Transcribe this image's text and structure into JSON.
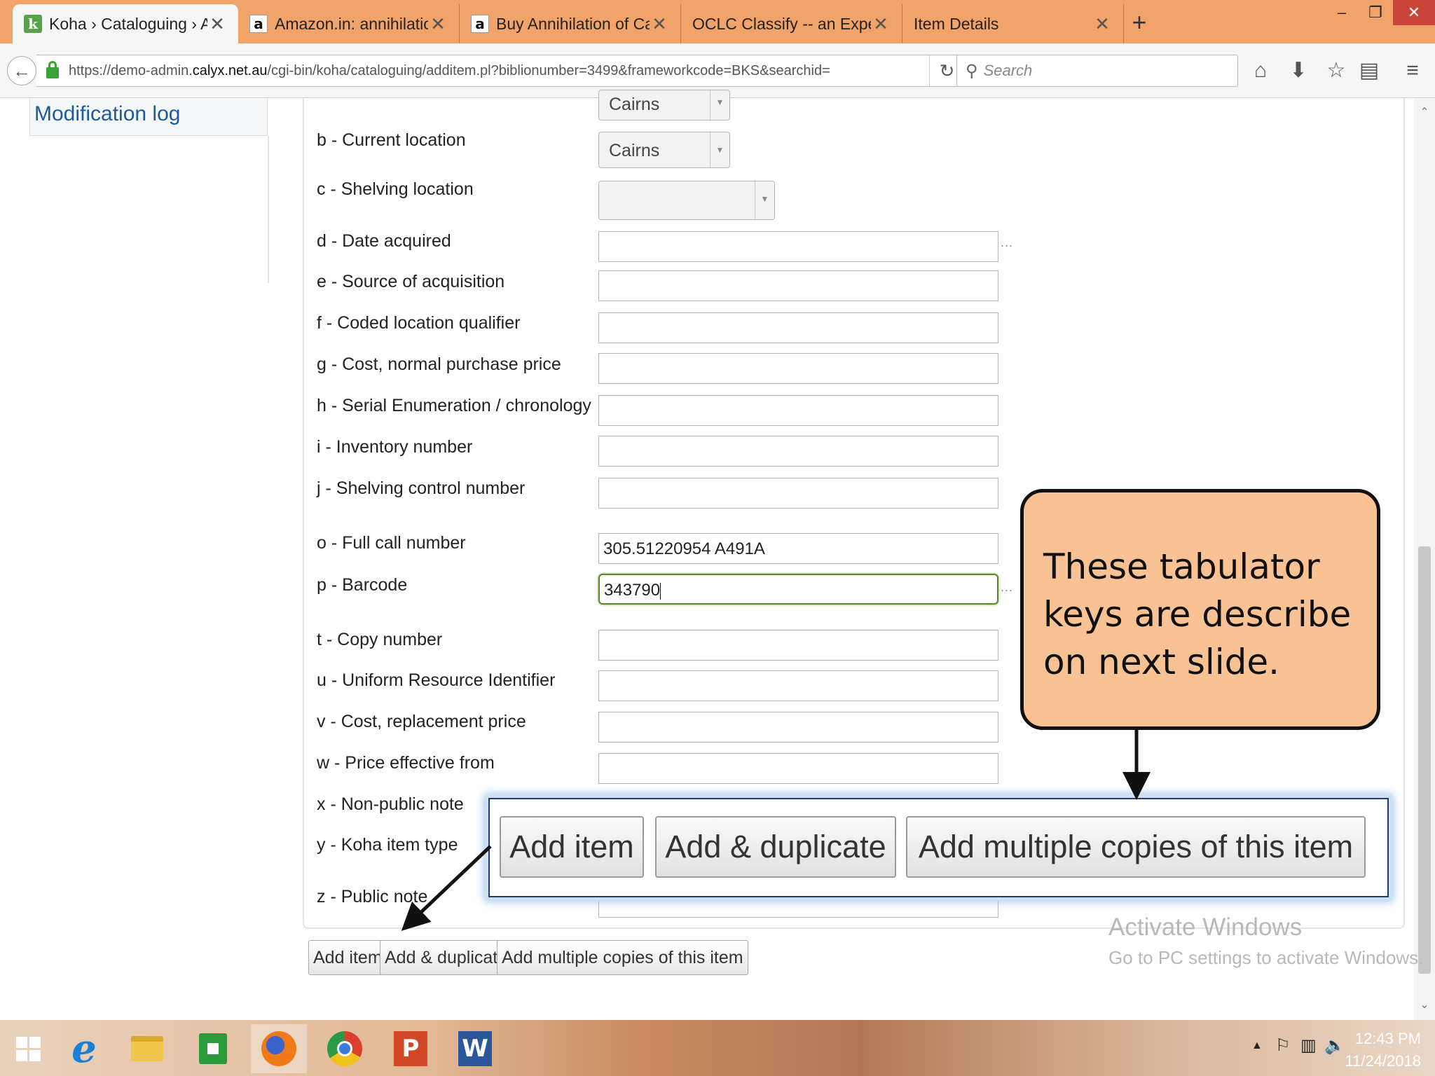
{
  "tabs": [
    {
      "label": "Koha › Cataloguing › Anni...",
      "favicon": "koha-icon",
      "favicon_text": "k",
      "active": true
    },
    {
      "label": "Amazon.in: annihilation o...",
      "favicon": "amazon-icon",
      "favicon_text": "a"
    },
    {
      "label": "Buy Annihilation of Caste:...",
      "favicon": "amazon-icon",
      "favicon_text": "a"
    },
    {
      "label": "OCLC Classify -- an Experimen...",
      "favicon": "none"
    },
    {
      "label": "Item Details",
      "favicon": "none"
    }
  ],
  "glyphs": {
    "close": "✕",
    "new_tab": "+",
    "minimize": "–",
    "restore": "❐",
    "back": "←",
    "reload": "↻",
    "search": "⚲",
    "home": "⌂",
    "download": "⬇",
    "bookmark": "☆",
    "reading_list": "▤",
    "menu": "≡",
    "select_arrow": "▼",
    "dots": "...",
    "scroll_up": "⌃",
    "scroll_down": "⌄",
    "tray_up": "▲",
    "tray_flag": "⚐",
    "tray_network": "▥",
    "tray_volume": "🔈"
  },
  "navbar": {
    "url_prefix": "https://demo-admin.",
    "url_domain": "calyx.net.au",
    "url_path": "/cgi-bin/koha/cataloguing/additem.pl?biblionumber=3499&frameworkcode=BKS&searchid=",
    "search_placeholder": "Search"
  },
  "sidebar": {
    "link": "Modification log"
  },
  "form": {
    "top_select": "Cairns",
    "fields": [
      {
        "code": "b",
        "label": "b - Current location",
        "type": "select",
        "value": "Cairns"
      },
      {
        "code": "c",
        "label": "c - Shelving location",
        "type": "select",
        "value": ""
      },
      {
        "code": "d",
        "label": "d - Date acquired",
        "type": "text",
        "value": "",
        "dots": true
      },
      {
        "code": "e",
        "label": "e - Source of acquisition",
        "type": "text",
        "value": ""
      },
      {
        "code": "f",
        "label": "f - Coded location qualifier",
        "type": "text",
        "value": ""
      },
      {
        "code": "g",
        "label": "g - Cost, normal purchase price",
        "type": "text",
        "value": ""
      },
      {
        "code": "h",
        "label": "h - Serial Enumeration / chronology",
        "type": "text",
        "value": ""
      },
      {
        "code": "i",
        "label": "i - Inventory number",
        "type": "text",
        "value": ""
      },
      {
        "code": "j",
        "label": "j - Shelving control number",
        "type": "text",
        "value": ""
      },
      {
        "code": "o",
        "label": "o - Full call number",
        "type": "text",
        "value": "305.51220954 A491A"
      },
      {
        "code": "p",
        "label": "p - Barcode",
        "type": "text",
        "value": "343790",
        "focused": true,
        "dots": true
      },
      {
        "code": "t",
        "label": "t - Copy number",
        "type": "text",
        "value": ""
      },
      {
        "code": "u",
        "label": "u - Uniform Resource Identifier",
        "type": "text",
        "value": ""
      },
      {
        "code": "v",
        "label": "v - Cost, replacement price",
        "type": "text",
        "value": ""
      },
      {
        "code": "w",
        "label": "w - Price effective from",
        "type": "text",
        "value": ""
      },
      {
        "code": "x",
        "label": "x - Non-public note",
        "type": "text",
        "value": ""
      },
      {
        "code": "y",
        "label": "y - Koha item type",
        "type": "text",
        "value": ""
      },
      {
        "code": "z",
        "label": "z - Public note",
        "type": "text",
        "value": ""
      }
    ],
    "buttons": {
      "add_item": "Add item",
      "add_duplicate": "Add & duplicate",
      "add_multiple": "Add multiple copies of this item"
    }
  },
  "callout": {
    "text": "These tabulator keys are describe on next slide."
  },
  "watermark": {
    "title": "Activate Windows",
    "subtitle": "Go to PC settings to activate Windows."
  },
  "taskbar": {
    "ie_glyph": "e",
    "ppt_glyph": "P",
    "word_glyph": "W",
    "time": "12:43 PM",
    "date": "11/24/2018"
  }
}
